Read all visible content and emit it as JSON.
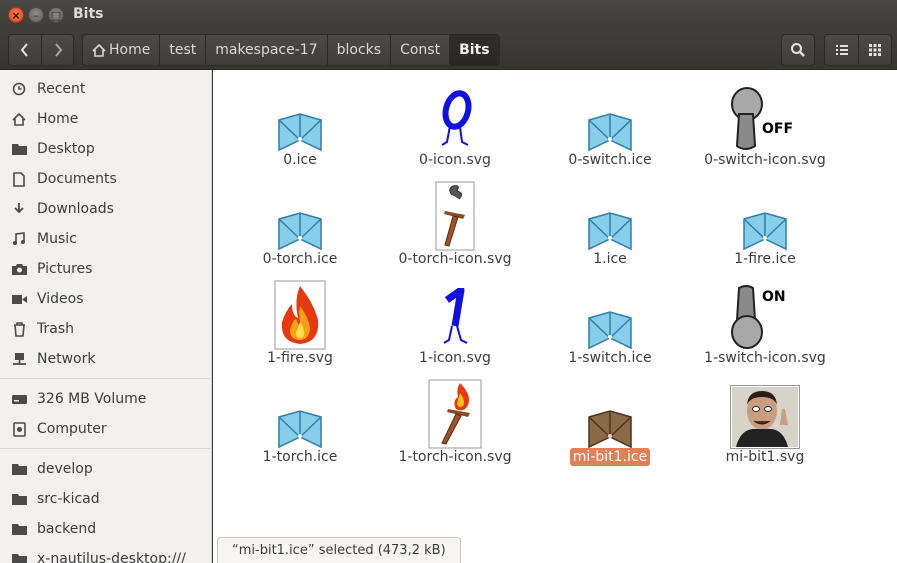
{
  "window": {
    "title": "Bits"
  },
  "nav": {
    "back_icon": "chevron-left-icon",
    "forward_icon": "chevron-right-icon"
  },
  "breadcrumbs": [
    {
      "label": "Home",
      "icon": "home-icon"
    },
    {
      "label": "test"
    },
    {
      "label": "makespace-17"
    },
    {
      "label": "blocks"
    },
    {
      "label": "Const"
    },
    {
      "label": "Bits",
      "active": true
    }
  ],
  "toolbar": {
    "search_icon": "search-icon",
    "list_view_icon": "list-view-icon",
    "grid_view_icon": "grid-view-icon"
  },
  "sidebar": {
    "items": [
      {
        "label": "Recent",
        "icon": "clock-icon"
      },
      {
        "label": "Home",
        "icon": "home-icon"
      },
      {
        "label": "Desktop",
        "icon": "folder-icon"
      },
      {
        "label": "Documents",
        "icon": "document-icon"
      },
      {
        "label": "Downloads",
        "icon": "download-icon"
      },
      {
        "label": "Music",
        "icon": "music-icon"
      },
      {
        "label": "Pictures",
        "icon": "camera-icon"
      },
      {
        "label": "Videos",
        "icon": "video-icon"
      },
      {
        "label": "Trash",
        "icon": "trash-icon"
      },
      {
        "label": "Network",
        "icon": "network-icon"
      },
      {
        "label": "326 MB Volume",
        "icon": "drive-icon"
      },
      {
        "label": "Computer",
        "icon": "computer-icon"
      },
      {
        "label": "develop",
        "icon": "folder-icon"
      },
      {
        "label": "src-kicad",
        "icon": "folder-icon"
      },
      {
        "label": "backend",
        "icon": "folder-icon"
      },
      {
        "label": "x-nautilus-desktop:///",
        "icon": "folder-icon"
      }
    ]
  },
  "files": [
    {
      "name": "0.ice",
      "icon": "ice-block-icon"
    },
    {
      "name": "0-icon.svg",
      "icon": "zero-digit-icon"
    },
    {
      "name": "0-switch.ice",
      "icon": "ice-block-icon"
    },
    {
      "name": "0-switch-icon.svg",
      "icon": "switch-off-icon",
      "caption": "OFF"
    },
    {
      "name": "0-torch.ice",
      "icon": "ice-block-icon"
    },
    {
      "name": "0-torch-icon.svg",
      "icon": "smoking-torch-icon"
    },
    {
      "name": "1.ice",
      "icon": "ice-block-icon"
    },
    {
      "name": "1-fire.ice",
      "icon": "ice-block-icon"
    },
    {
      "name": "1-fire.svg",
      "icon": "fire-icon"
    },
    {
      "name": "1-icon.svg",
      "icon": "one-digit-icon"
    },
    {
      "name": "1-switch.ice",
      "icon": "ice-block-icon"
    },
    {
      "name": "1-switch-icon.svg",
      "icon": "switch-on-icon",
      "caption": "ON"
    },
    {
      "name": "1-torch.ice",
      "icon": "ice-block-icon"
    },
    {
      "name": "1-torch-icon.svg",
      "icon": "burning-torch-icon"
    },
    {
      "name": "mi-bit1.ice",
      "icon": "ice-block-brown-icon",
      "selected": true
    },
    {
      "name": "mi-bit1.svg",
      "icon": "photo-thumbnail-icon"
    }
  ],
  "status": {
    "text": "“mi-bit1.ice” selected  (473,2 kB)"
  },
  "colors": {
    "accent": "#e67e56",
    "ice_blue": "#87ceeb",
    "ice_brown": "#8b6a45",
    "digit_blue": "#1010e0"
  }
}
